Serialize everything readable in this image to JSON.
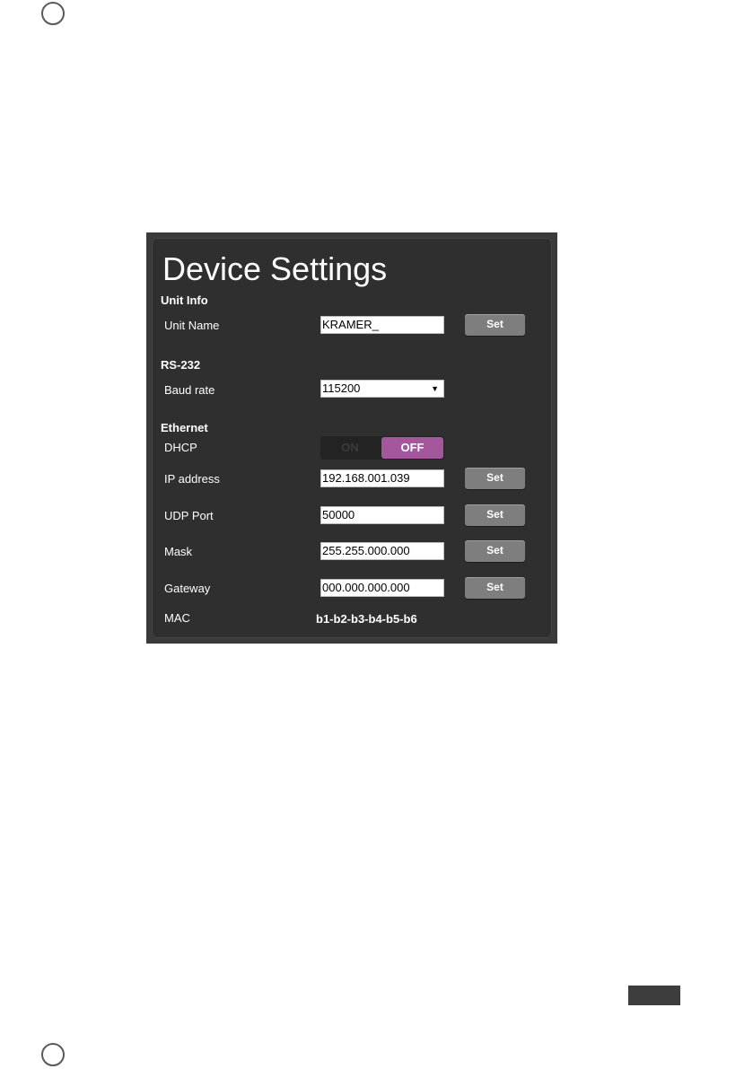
{
  "page": {
    "title": "Device Settings"
  },
  "unit_info": {
    "heading": "Unit Info",
    "unit_name_label": "Unit Name",
    "unit_name_value": "KRAMER_",
    "set_label": "Set"
  },
  "rs232": {
    "heading": "RS-232",
    "baud_label": "Baud rate",
    "baud_value": "115200",
    "dropdown_arrow": "▼"
  },
  "ethernet": {
    "heading": "Ethernet",
    "dhcp_label": "DHCP",
    "dhcp_on": "ON",
    "dhcp_off": "OFF",
    "dhcp_state": "OFF",
    "ip_label": "IP address",
    "ip_value": "192.168.001.039",
    "udp_label": "UDP Port",
    "udp_value": "50000",
    "mask_label": "Mask",
    "mask_value": "255.255.000.000",
    "gateway_label": "Gateway",
    "gateway_value": "000.000.000.000",
    "mac_label": "MAC",
    "mac_value": "b1-b2-b3-b4-b5-b6",
    "set_label": "Set"
  },
  "colors": {
    "panel_bg": "#2f2f2f",
    "button_bg": "#7e7e7e",
    "toggle_active": "#a5579e"
  }
}
